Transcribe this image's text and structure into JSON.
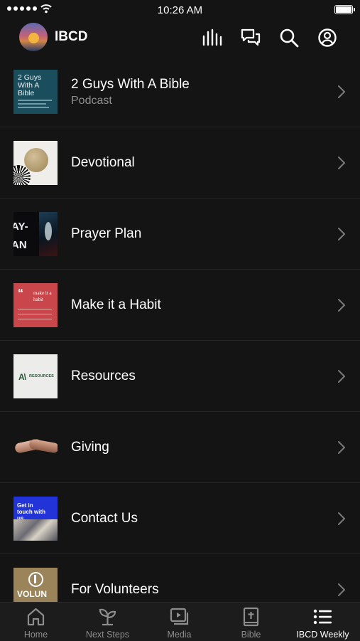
{
  "status_bar": {
    "time": "10:26 AM"
  },
  "header": {
    "app_name": "IBCD",
    "icons": [
      "avatar-logo",
      "bars-icon",
      "chat-icon",
      "search-icon",
      "profile-icon"
    ]
  },
  "list_items": [
    {
      "title": "2 Guys With A Bible",
      "subtitle": "Podcast",
      "thumb_text": "2 Guys With A Bible",
      "icon": "podcast-art"
    },
    {
      "title": "Devotional",
      "icon": "devotional-art"
    },
    {
      "title": "Prayer Plan",
      "thumb_text": "AY- AN",
      "icon": "prayer-art"
    },
    {
      "title": "Make it a Habit",
      "thumb_text": "make it a habit",
      "icon": "habit-art"
    },
    {
      "title": "Resources",
      "thumb_text": "RESOURCES",
      "icon": "resources-art"
    },
    {
      "title": "Giving",
      "icon": "giving-art"
    },
    {
      "title": "Contact Us",
      "thumb_text": "Get in touch with us",
      "icon": "contact-art"
    },
    {
      "title": "For Volunteers",
      "thumb_text": "VOLUN",
      "icon": "volunteer-art"
    }
  ],
  "tabs": [
    {
      "label": "Home",
      "icon": "home-icon",
      "active": false
    },
    {
      "label": "Next Steps",
      "icon": "sprout-icon",
      "active": false
    },
    {
      "label": "Media",
      "icon": "media-icon",
      "active": false
    },
    {
      "label": "Bible",
      "icon": "bible-icon",
      "active": false
    },
    {
      "label": "IBCD Weekly",
      "icon": "list-icon",
      "active": true
    }
  ],
  "colors": {
    "background": "#141414",
    "tabbar": "#1c1c1c",
    "subtitle": "#8f8f8f",
    "inactive_tab": "#8d8d8d",
    "active_tab": "#ffffff"
  }
}
